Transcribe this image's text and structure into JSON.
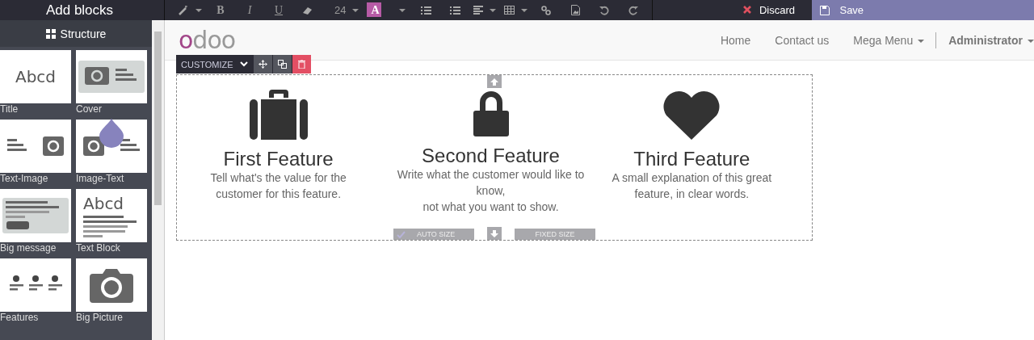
{
  "sidebar": {
    "title": "Add blocks",
    "section": "Structure",
    "blocks": [
      {
        "label": "Title",
        "kind": "title",
        "sample": "Abcd"
      },
      {
        "label": "Cover",
        "kind": "cover"
      },
      {
        "label": "Text-Image",
        "kind": "text-image"
      },
      {
        "label": "Image-Text",
        "kind": "image-text"
      },
      {
        "label": "Big message",
        "kind": "message"
      },
      {
        "label": "Text Block",
        "kind": "textblock",
        "sample": "Abcd"
      },
      {
        "label": "Features",
        "kind": "features"
      },
      {
        "label": "Big Picture",
        "kind": "picture"
      }
    ]
  },
  "toolbar": [
    {
      "kind": "wand"
    },
    {
      "kind": "bold",
      "label": "B"
    },
    {
      "kind": "italic",
      "label": "I"
    },
    {
      "kind": "underline",
      "label": "U"
    },
    {
      "kind": "eraser"
    },
    {
      "kind": "size",
      "label": "24"
    },
    {
      "kind": "color",
      "label": "A"
    },
    {
      "kind": "ul"
    },
    {
      "kind": "ol"
    },
    {
      "kind": "align"
    },
    {
      "kind": "table"
    },
    {
      "kind": "link"
    },
    {
      "kind": "image"
    },
    {
      "kind": "undo"
    },
    {
      "kind": "redo"
    }
  ],
  "actions": {
    "discard": "Discard",
    "save": "Save"
  },
  "site": {
    "logo": "odoo",
    "nav": [
      {
        "label": "Home",
        "dropdown": false
      },
      {
        "label": "Contact us",
        "dropdown": false
      },
      {
        "label": "Mega Menu",
        "dropdown": true
      }
    ],
    "user": "Administrator"
  },
  "editor": {
    "customize": "CUSTOMIZE",
    "auto_size": "AUTO SIZE",
    "fixed_size": "FIXED SIZE"
  },
  "features": [
    {
      "kind": "briefcase",
      "title": "First Feature",
      "lines": [
        "Tell what's the value for the",
        "customer for this feature."
      ]
    },
    {
      "kind": "lock",
      "title": "Second Feature",
      "lines": [
        "Write what the customer would like to",
        "know,",
        "not what you want to show."
      ]
    },
    {
      "kind": "heart",
      "title": "Third Feature",
      "lines": [
        "A small explanation of this great",
        "feature, in clear words."
      ]
    }
  ]
}
